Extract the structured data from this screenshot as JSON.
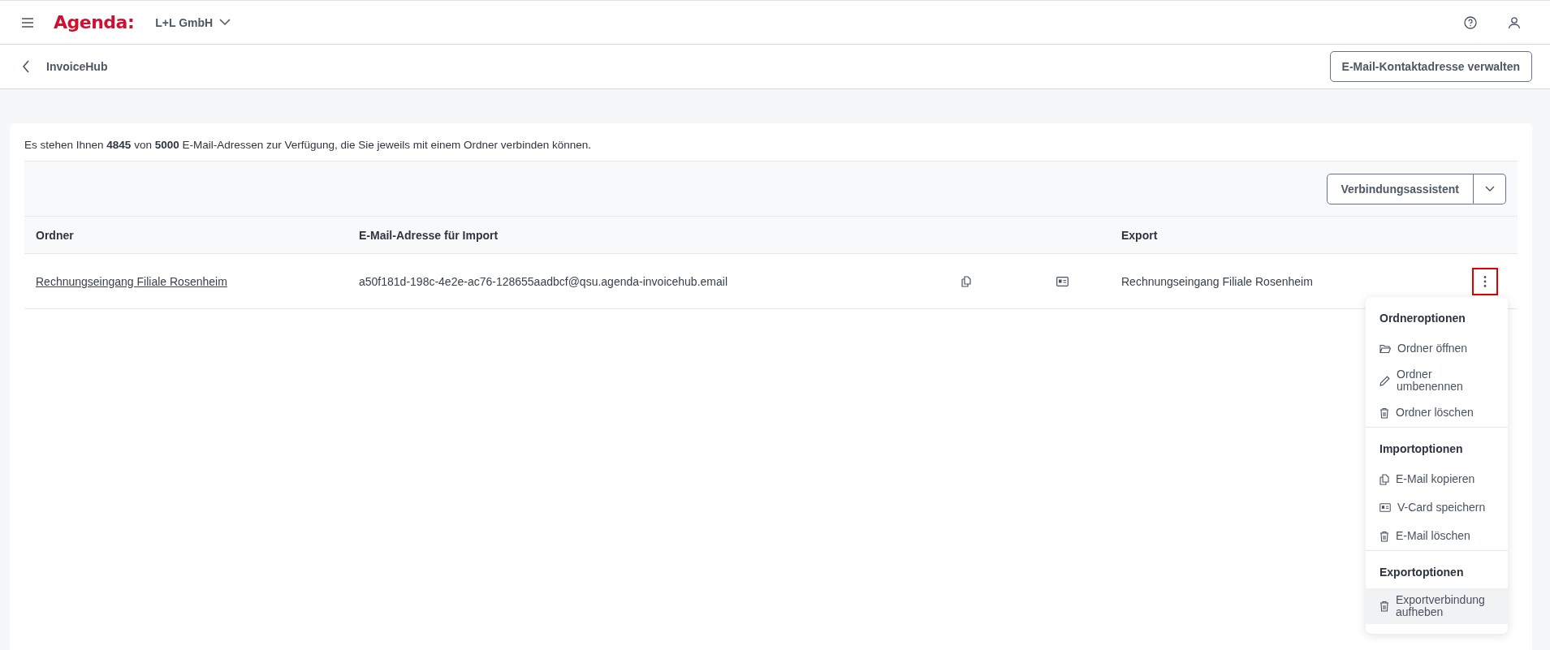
{
  "top_bar": {
    "logo": "Agenda:",
    "company": "L+L GmbH"
  },
  "sub_bar": {
    "title": "InvoiceHub",
    "button": "E-Mail-Kontaktadresse verwalten"
  },
  "info_text": "Es stehen Ihnen **4845** von **5000** E-Mail-Adressen zur Verfügung, die Sie jeweils mit einem Ordner verbinden können.",
  "toolbar": {
    "button": "Verbindungsassistent"
  },
  "table": {
    "columns": [
      "Ordner",
      "E-Mail-Adresse für Import",
      "Export"
    ],
    "rows": [
      {
        "folder": "Rechnungseingang Filiale Rosenheim",
        "email": "a50f181d-198c-4e2e-ac76-128655aadbcf@qsu.agenda-invoicehub.email",
        "export": "Rechnungseingang Filiale Rosenheim",
        "menu_open": true
      }
    ]
  },
  "menu": {
    "sections": [
      {
        "title": "Ordneroptionen",
        "items": [
          {
            "kind": "folder",
            "label": "Ordner öffnen",
            "selected": false
          },
          {
            "kind": "pencil",
            "label": "Ordner umbenennen",
            "selected": false
          },
          {
            "kind": "trash",
            "label": "Ordner löschen",
            "selected": false
          }
        ]
      },
      {
        "title": "Importoptionen",
        "items": [
          {
            "kind": "copy",
            "label": "E-Mail kopieren",
            "selected": false
          },
          {
            "kind": "card",
            "label": "V-Card speichern",
            "selected": false
          },
          {
            "kind": "trash",
            "label": "E-Mail löschen",
            "selected": false
          }
        ]
      },
      {
        "title": "Exportoptionen",
        "items": [
          {
            "kind": "trash",
            "label": "Exportverbindung aufheben",
            "selected": true
          }
        ]
      }
    ]
  }
}
